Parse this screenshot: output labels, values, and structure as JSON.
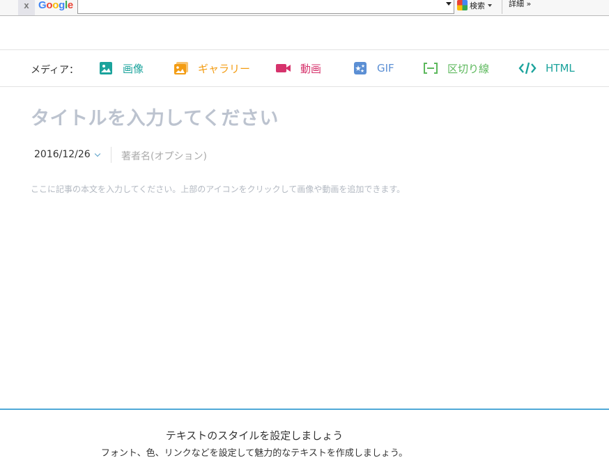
{
  "toolbar": {
    "close_glyph": "x",
    "logo_letters": [
      "G",
      "o",
      "o",
      "g",
      "l",
      "e"
    ],
    "logo_colors": [
      "#4285f4",
      "#ea4335",
      "#fbbc05",
      "#4285f4",
      "#34a853",
      "#ea4335"
    ],
    "search_value": "",
    "search_button_label": "検索",
    "detail_label": "詳細 »"
  },
  "media": {
    "label": "メディア：",
    "items": [
      {
        "label": "画像",
        "icon": "image-icon",
        "color": "#1ba39c"
      },
      {
        "label": "ギャラリー",
        "icon": "gallery-icon",
        "color": "#f39c12"
      },
      {
        "label": "動画",
        "icon": "video-icon",
        "color": "#d6336c"
      },
      {
        "label": "GIF",
        "icon": "gif-icon",
        "color": "#5b8fd4"
      },
      {
        "label": "区切り線",
        "icon": "divider-icon",
        "color": "#5cb85c"
      },
      {
        "label": "HTML",
        "icon": "html-code-icon",
        "color": "#1ba39c"
      }
    ]
  },
  "editor": {
    "title_placeholder": "タイトルを入力してください",
    "date": "2016/12/26",
    "author_placeholder": "著者名(オプション)",
    "body_placeholder": "ここに記事の本文を入力してください。上部のアイコンをクリックして画像や動画を追加できます。"
  },
  "footer": {
    "title": "テキストのスタイルを設定しましょう",
    "subtitle": "フォント、色、リンクなどを設定して魅力的なテキストを作成しましょう。"
  }
}
